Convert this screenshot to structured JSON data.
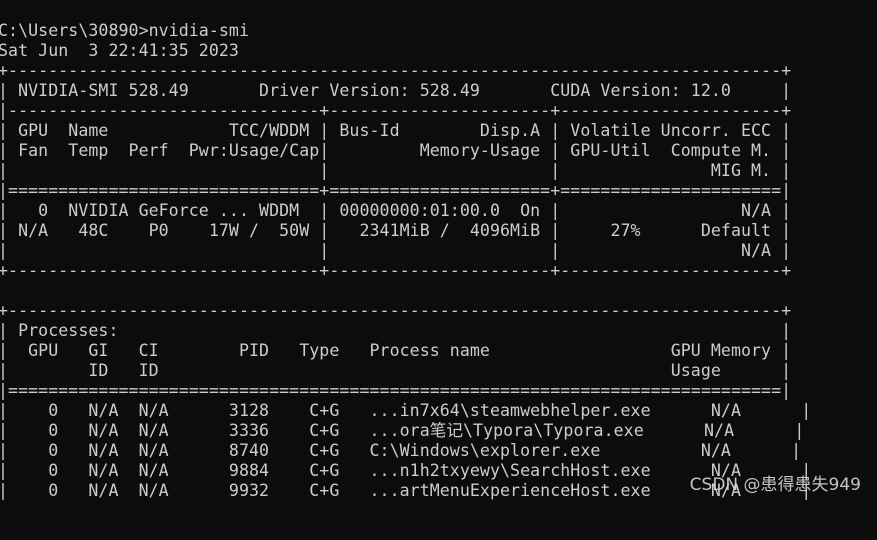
{
  "terminal": {
    "lines": [
      "C:\\Users\\30890>nvidia-smi",
      "Sat Jun  3 22:41:35 2023",
      "+-----------------------------------------------------------------------------+",
      "| NVIDIA-SMI 528.49       Driver Version: 528.49       CUDA Version: 12.0     |",
      "|-------------------------------+----------------------+----------------------+",
      "| GPU  Name            TCC/WDDM | Bus-Id        Disp.A | Volatile Uncorr. ECC |",
      "| Fan  Temp  Perf  Pwr:Usage/Cap|         Memory-Usage | GPU-Util  Compute M. |",
      "|                               |                      |               MIG M. |",
      "|===============================+======================+======================|",
      "|   0  NVIDIA GeForce ... WDDM  | 00000000:01:00.0  On |                  N/A |",
      "| N/A   48C    P0    17W /  50W |   2341MiB /  4096MiB |     27%      Default |",
      "|                               |                      |                  N/A |",
      "+-------------------------------+----------------------+----------------------+",
      "",
      "+-----------------------------------------------------------------------------+",
      "| Processes:                                                                  |",
      "|  GPU   GI   CI        PID   Type   Process name                  GPU Memory |",
      "|        ID   ID                                                   Usage      |",
      "|=============================================================================|",
      "|    0   N/A  N/A      3128    C+G   ...in7x64\\steamwebhelper.exe      N/A      |",
      "|    0   N/A  N/A      3336    C+G   ...ora笔记\\Typora\\Typora.exe      N/A      |",
      "|    0   N/A  N/A      8740    C+G   C:\\Windows\\explorer.exe          N/A      |",
      "|    0   N/A  N/A      9884    C+G   ...n1h2txyewy\\SearchHost.exe      N/A      |",
      "|    0   N/A  N/A      9932    C+G   ...artMenuExperienceHost.exe      N/A      |"
    ]
  },
  "watermark": {
    "text": "CSDN @患得患失949"
  }
}
